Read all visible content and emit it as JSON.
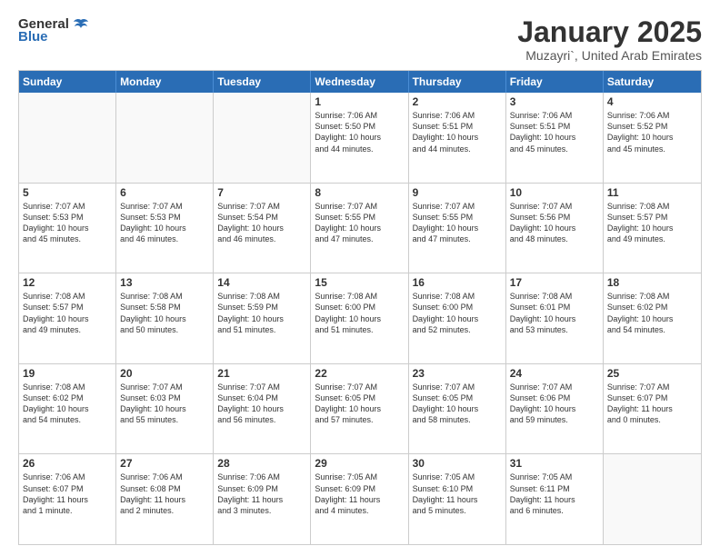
{
  "header": {
    "logo_general": "General",
    "logo_blue": "Blue",
    "month_title": "January 2025",
    "location": "Muzayri`, United Arab Emirates"
  },
  "calendar": {
    "weekdays": [
      "Sunday",
      "Monday",
      "Tuesday",
      "Wednesday",
      "Thursday",
      "Friday",
      "Saturday"
    ],
    "rows": [
      [
        {
          "day": "",
          "empty": true
        },
        {
          "day": "",
          "empty": true
        },
        {
          "day": "",
          "empty": true
        },
        {
          "day": "1",
          "lines": [
            "Sunrise: 7:06 AM",
            "Sunset: 5:50 PM",
            "Daylight: 10 hours",
            "and 44 minutes."
          ]
        },
        {
          "day": "2",
          "lines": [
            "Sunrise: 7:06 AM",
            "Sunset: 5:51 PM",
            "Daylight: 10 hours",
            "and 44 minutes."
          ]
        },
        {
          "day": "3",
          "lines": [
            "Sunrise: 7:06 AM",
            "Sunset: 5:51 PM",
            "Daylight: 10 hours",
            "and 45 minutes."
          ]
        },
        {
          "day": "4",
          "lines": [
            "Sunrise: 7:06 AM",
            "Sunset: 5:52 PM",
            "Daylight: 10 hours",
            "and 45 minutes."
          ]
        }
      ],
      [
        {
          "day": "5",
          "lines": [
            "Sunrise: 7:07 AM",
            "Sunset: 5:53 PM",
            "Daylight: 10 hours",
            "and 45 minutes."
          ]
        },
        {
          "day": "6",
          "lines": [
            "Sunrise: 7:07 AM",
            "Sunset: 5:53 PM",
            "Daylight: 10 hours",
            "and 46 minutes."
          ]
        },
        {
          "day": "7",
          "lines": [
            "Sunrise: 7:07 AM",
            "Sunset: 5:54 PM",
            "Daylight: 10 hours",
            "and 46 minutes."
          ]
        },
        {
          "day": "8",
          "lines": [
            "Sunrise: 7:07 AM",
            "Sunset: 5:55 PM",
            "Daylight: 10 hours",
            "and 47 minutes."
          ]
        },
        {
          "day": "9",
          "lines": [
            "Sunrise: 7:07 AM",
            "Sunset: 5:55 PM",
            "Daylight: 10 hours",
            "and 47 minutes."
          ]
        },
        {
          "day": "10",
          "lines": [
            "Sunrise: 7:07 AM",
            "Sunset: 5:56 PM",
            "Daylight: 10 hours",
            "and 48 minutes."
          ]
        },
        {
          "day": "11",
          "lines": [
            "Sunrise: 7:08 AM",
            "Sunset: 5:57 PM",
            "Daylight: 10 hours",
            "and 49 minutes."
          ]
        }
      ],
      [
        {
          "day": "12",
          "lines": [
            "Sunrise: 7:08 AM",
            "Sunset: 5:57 PM",
            "Daylight: 10 hours",
            "and 49 minutes."
          ]
        },
        {
          "day": "13",
          "lines": [
            "Sunrise: 7:08 AM",
            "Sunset: 5:58 PM",
            "Daylight: 10 hours",
            "and 50 minutes."
          ]
        },
        {
          "day": "14",
          "lines": [
            "Sunrise: 7:08 AM",
            "Sunset: 5:59 PM",
            "Daylight: 10 hours",
            "and 51 minutes."
          ]
        },
        {
          "day": "15",
          "lines": [
            "Sunrise: 7:08 AM",
            "Sunset: 6:00 PM",
            "Daylight: 10 hours",
            "and 51 minutes."
          ]
        },
        {
          "day": "16",
          "lines": [
            "Sunrise: 7:08 AM",
            "Sunset: 6:00 PM",
            "Daylight: 10 hours",
            "and 52 minutes."
          ]
        },
        {
          "day": "17",
          "lines": [
            "Sunrise: 7:08 AM",
            "Sunset: 6:01 PM",
            "Daylight: 10 hours",
            "and 53 minutes."
          ]
        },
        {
          "day": "18",
          "lines": [
            "Sunrise: 7:08 AM",
            "Sunset: 6:02 PM",
            "Daylight: 10 hours",
            "and 54 minutes."
          ]
        }
      ],
      [
        {
          "day": "19",
          "lines": [
            "Sunrise: 7:08 AM",
            "Sunset: 6:02 PM",
            "Daylight: 10 hours",
            "and 54 minutes."
          ]
        },
        {
          "day": "20",
          "lines": [
            "Sunrise: 7:07 AM",
            "Sunset: 6:03 PM",
            "Daylight: 10 hours",
            "and 55 minutes."
          ]
        },
        {
          "day": "21",
          "lines": [
            "Sunrise: 7:07 AM",
            "Sunset: 6:04 PM",
            "Daylight: 10 hours",
            "and 56 minutes."
          ]
        },
        {
          "day": "22",
          "lines": [
            "Sunrise: 7:07 AM",
            "Sunset: 6:05 PM",
            "Daylight: 10 hours",
            "and 57 minutes."
          ]
        },
        {
          "day": "23",
          "lines": [
            "Sunrise: 7:07 AM",
            "Sunset: 6:05 PM",
            "Daylight: 10 hours",
            "and 58 minutes."
          ]
        },
        {
          "day": "24",
          "lines": [
            "Sunrise: 7:07 AM",
            "Sunset: 6:06 PM",
            "Daylight: 10 hours",
            "and 59 minutes."
          ]
        },
        {
          "day": "25",
          "lines": [
            "Sunrise: 7:07 AM",
            "Sunset: 6:07 PM",
            "Daylight: 11 hours",
            "and 0 minutes."
          ]
        }
      ],
      [
        {
          "day": "26",
          "lines": [
            "Sunrise: 7:06 AM",
            "Sunset: 6:07 PM",
            "Daylight: 11 hours",
            "and 1 minute."
          ]
        },
        {
          "day": "27",
          "lines": [
            "Sunrise: 7:06 AM",
            "Sunset: 6:08 PM",
            "Daylight: 11 hours",
            "and 2 minutes."
          ]
        },
        {
          "day": "28",
          "lines": [
            "Sunrise: 7:06 AM",
            "Sunset: 6:09 PM",
            "Daylight: 11 hours",
            "and 3 minutes."
          ]
        },
        {
          "day": "29",
          "lines": [
            "Sunrise: 7:05 AM",
            "Sunset: 6:09 PM",
            "Daylight: 11 hours",
            "and 4 minutes."
          ]
        },
        {
          "day": "30",
          "lines": [
            "Sunrise: 7:05 AM",
            "Sunset: 6:10 PM",
            "Daylight: 11 hours",
            "and 5 minutes."
          ]
        },
        {
          "day": "31",
          "lines": [
            "Sunrise: 7:05 AM",
            "Sunset: 6:11 PM",
            "Daylight: 11 hours",
            "and 6 minutes."
          ]
        },
        {
          "day": "",
          "empty": true
        }
      ]
    ]
  }
}
